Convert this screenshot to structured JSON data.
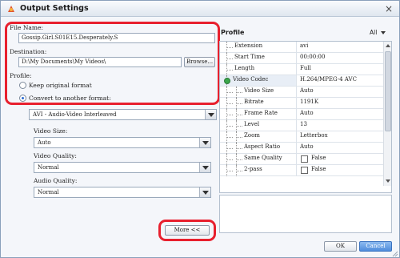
{
  "window": {
    "title": "Output Settings",
    "close_glyph": "×",
    "icon": "app-icon"
  },
  "file_name": {
    "label": "File Name:",
    "value": "Gossip.Girl.S01E15.Desperately.S"
  },
  "destination": {
    "label": "Destination:",
    "value": "D:\\My Documents\\My Videos\\",
    "browse_label": "Browse..."
  },
  "profile_left": {
    "label": "Profile:",
    "option_keep": "Keep original format",
    "option_convert": "Convert to another format:",
    "selected": "convert",
    "format_value": "AVI - Audio-Video Interleaved"
  },
  "video_size": {
    "label": "Video Size:",
    "value": "Auto"
  },
  "video_quality": {
    "label": "Video Quality:",
    "value": "Normal"
  },
  "audio_quality": {
    "label": "Audio Quality:",
    "value": "Normal"
  },
  "more_button": {
    "label": "More <<"
  },
  "profile_panel": {
    "title": "Profile",
    "filter_label": "All",
    "rows": [
      {
        "key": "Extension",
        "value": "avi"
      },
      {
        "key": "Start Time",
        "value": "00:00:00"
      },
      {
        "key": "Length",
        "value": "Full"
      },
      {
        "key": "Video Codec",
        "value": "H.264/MPEG-4 AVC"
      },
      {
        "key": "Video Size",
        "value": "Auto"
      },
      {
        "key": "Bitrate",
        "value": "1191K"
      },
      {
        "key": "Frame Rate",
        "value": "Auto"
      },
      {
        "key": "Level",
        "value": "13"
      },
      {
        "key": "Zoom",
        "value": "Letterbox"
      },
      {
        "key": "Aspect Ratio",
        "value": "Auto"
      },
      {
        "key": "Same Quality",
        "value": "False"
      },
      {
        "key": "2-pass",
        "value": "False"
      }
    ]
  },
  "footer": {
    "ok_label": "OK",
    "cancel_label": "Cancel"
  },
  "colors": {
    "highlight": "#e8202e",
    "accent": "#2b6bd3",
    "cancel_bg": "#5b97e3"
  }
}
